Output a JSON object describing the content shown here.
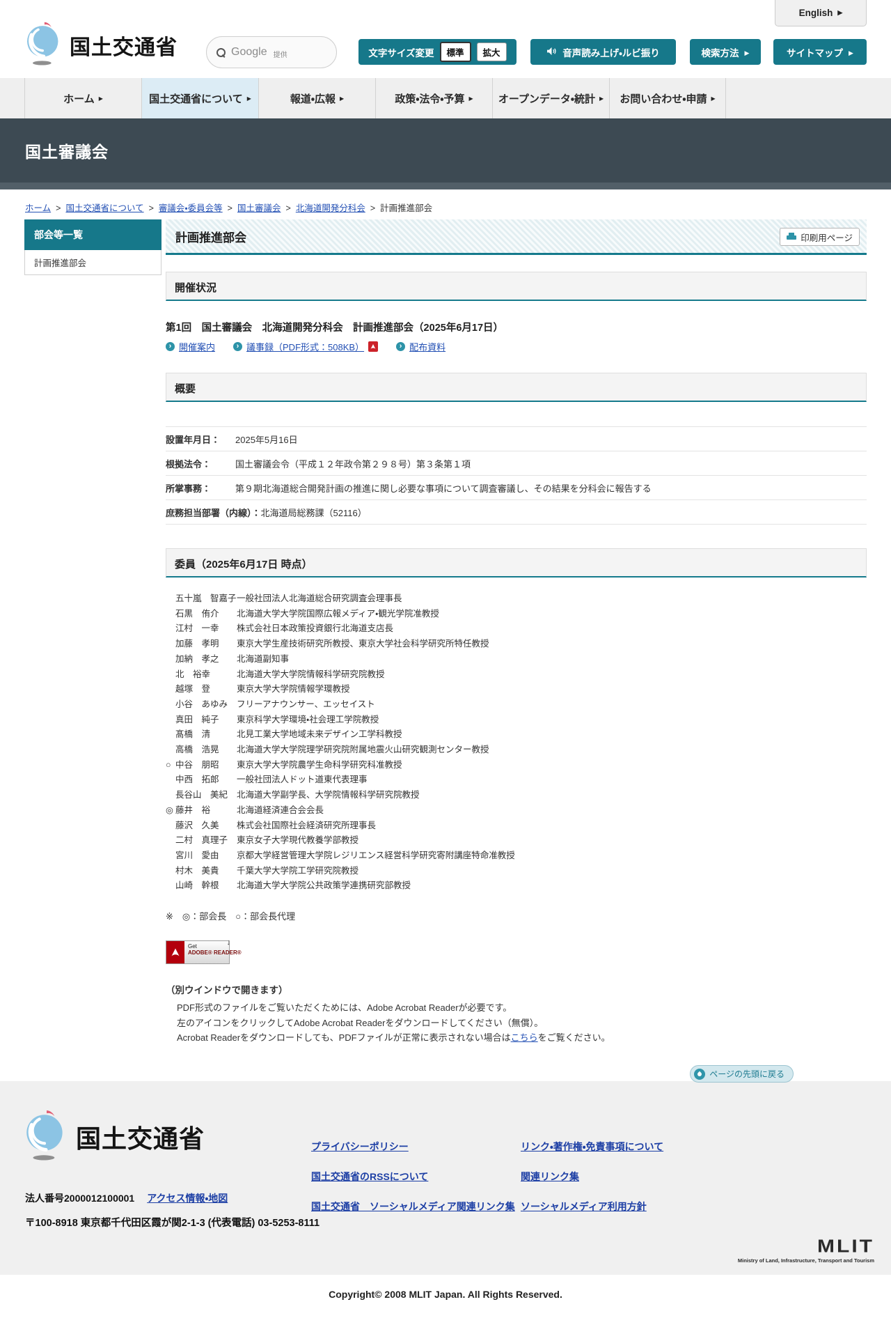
{
  "colors": {
    "accent_teal": "#16788a",
    "link_blue": "#2350b4",
    "footer_link_blue": "#1d3fa5",
    "hero_dark": "#3d4a53",
    "nav_active_bg": "#dcecf5",
    "pdf_red": "#cc2229",
    "logo_blue": "#8cc4e4",
    "logo_red": "#e15f75"
  },
  "icons": {
    "chevron_right": "▶",
    "breadcrumb_separator": ">",
    "circle_arrow": "›",
    "download_arrow": "↓"
  },
  "header": {
    "logo_text": "国土交通省",
    "english_button": "English",
    "search_brand": "Google",
    "search_provided": "提供",
    "font_size_button": "文字サイズ変更",
    "font_size_standard": "標準",
    "font_size_large": "拡大",
    "speech_button": "音声読み上げ・ルビ振り",
    "search_method_button": "検索方法",
    "sitemap_button": "サイトマップ"
  },
  "nav": {
    "items": [
      {
        "label": "ホーム"
      },
      {
        "label": "国土交通省について"
      },
      {
        "label": "報道・広報"
      },
      {
        "label": "政策・法令・予算"
      },
      {
        "label": "オープンデータ・統計"
      },
      {
        "label": "お問い合わせ・申請"
      }
    ]
  },
  "hero": {
    "title": "国土審議会"
  },
  "breadcrumb": {
    "items": [
      "ホーム",
      "国土交通省について",
      "審議会・委員会等",
      "国土審議会",
      "北海道開発分科会",
      "計画推進部会"
    ]
  },
  "sidebar": {
    "heading": "部会等一覧",
    "items": [
      {
        "label": "計画推進部会"
      }
    ]
  },
  "main": {
    "page_title": "計画推進部会",
    "print_button": "印刷用ページ",
    "section_kaisai": "開催状況",
    "section_gaiyo": "概要",
    "section_iin": "委員（2025年6月17日 時点）",
    "meeting": {
      "title": "第1回　国土審議会　北海道開発分科会　計画推進部会（2025年6月17日）",
      "link_annai": "開催案内",
      "link_gijiroku": "議事録（PDF形式：508KB）",
      "link_haifu": "配布資料"
    },
    "overview_rows": [
      {
        "label": "設置年月日：",
        "value": "2025年5月16日"
      },
      {
        "label": "根拠法令：",
        "value": "国土審議会令（平成１２年政令第２９８号）第３条第１項"
      },
      {
        "label": "所掌事務：",
        "value": "第９期北海道総合開発計画の推進に関し必要な事項について調査審議し、その結果を分科会に報告する"
      },
      {
        "label": "庶務担当部署（内線）：",
        "value": "北海道局総務課（52116）"
      }
    ],
    "members": [
      {
        "marker": "",
        "name": "五十嵐　智嘉子",
        "position": "一般社団法人北海道総合研究調査会理事長"
      },
      {
        "marker": "",
        "name": "石黒　侑介",
        "position": "北海道大学大学院国際広報メディア・観光学院准教授"
      },
      {
        "marker": "",
        "name": "江村　一幸",
        "position": "株式会社日本政策投資銀行北海道支店長"
      },
      {
        "marker": "",
        "name": "加藤　孝明",
        "position": "東京大学生産技術研究所教授、東京大学社会科学研究所特任教授"
      },
      {
        "marker": "",
        "name": "加納　孝之",
        "position": "北海道副知事"
      },
      {
        "marker": "",
        "name": "北　裕幸",
        "position": "北海道大学大学院情報科学研究院教授"
      },
      {
        "marker": "",
        "name": "越塚　登",
        "position": "東京大学大学院情報学環教授"
      },
      {
        "marker": "",
        "name": "小谷　あゆみ",
        "position": "フリーアナウンサー、エッセイスト"
      },
      {
        "marker": "",
        "name": "真田　純子",
        "position": "東京科学大学環境・社会理工学院教授"
      },
      {
        "marker": "",
        "name": "髙橋　清",
        "position": "北見工業大学地域未来デザイン工学科教授"
      },
      {
        "marker": "",
        "name": "高橋　浩晃",
        "position": "北海道大学大学院理学研究院附属地震火山研究観測センター教授"
      },
      {
        "marker": "○",
        "name": "中谷　朋昭",
        "position": "東京大学大学院農学生命科学研究科准教授"
      },
      {
        "marker": "",
        "name": "中西　拓郎",
        "position": "一般社団法人ドット道東代表理事"
      },
      {
        "marker": "",
        "name": "長谷山　美紀",
        "position": "北海道大学副学長、大学院情報科学研究院教授"
      },
      {
        "marker": "◎",
        "name": "藤井　裕",
        "position": "北海道経済連合会会長"
      },
      {
        "marker": "",
        "name": "藤沢　久美",
        "position": "株式会社国際社会経済研究所理事長"
      },
      {
        "marker": "",
        "name": "二村　真理子",
        "position": "東京女子大学現代教養学部教授"
      },
      {
        "marker": "",
        "name": "宮川　愛由",
        "position": "京都大学経営管理大学院レジリエンス経営科学研究寄附講座特命准教授"
      },
      {
        "marker": "",
        "name": "村木　美貴",
        "position": "千葉大学大学院工学研究院教授"
      },
      {
        "marker": "",
        "name": "山崎　幹根",
        "position": "北海道大学大学院公共政策学連携研究部教授"
      }
    ],
    "member_note": "※　◎：部会長　○：部会長代理",
    "adobe": {
      "badge_get": "Get",
      "badge_reader": "ADOBE® READER®",
      "note_title": "（別ウインドウで開きます）",
      "line1": "PDF形式のファイルをご覧いただくためには、Adobe Acrobat Readerが必要です。",
      "line2": "左のアイコンをクリックしてAdobe Acrobat Readerをダウンロードしてください（無償）。",
      "line3_pre": "Acrobat Readerをダウンロードしても、PDFファイルが正常に表示されない場合は",
      "line3_link": "こちら",
      "line3_post": "をご覧ください。"
    }
  },
  "footer": {
    "back_to_top": "ページの先頭に戻る",
    "logo_text": "国土交通省",
    "corporate_number": "法人番号2000012100001",
    "access_link": "アクセス情報・地図",
    "address": "〒100-8918 東京都千代田区霞が関2-1-3 (代表電話) 03-5253-8111",
    "links_col1": [
      "プライバシーポリシー",
      "国土交通省のRSSについて",
      "国土交通省　ソーシャルメディア関連リンク集"
    ],
    "links_col2": [
      "リンク・著作権・免責事項について",
      "関連リンク集",
      "ソーシャルメディア利用方針"
    ],
    "mlit_mark": "MLIT",
    "mlit_tagline": "Ministry of Land, Infrastructure, Transport and Tourism",
    "copyright": "Copyright© 2008 MLIT Japan. All Rights Reserved."
  }
}
